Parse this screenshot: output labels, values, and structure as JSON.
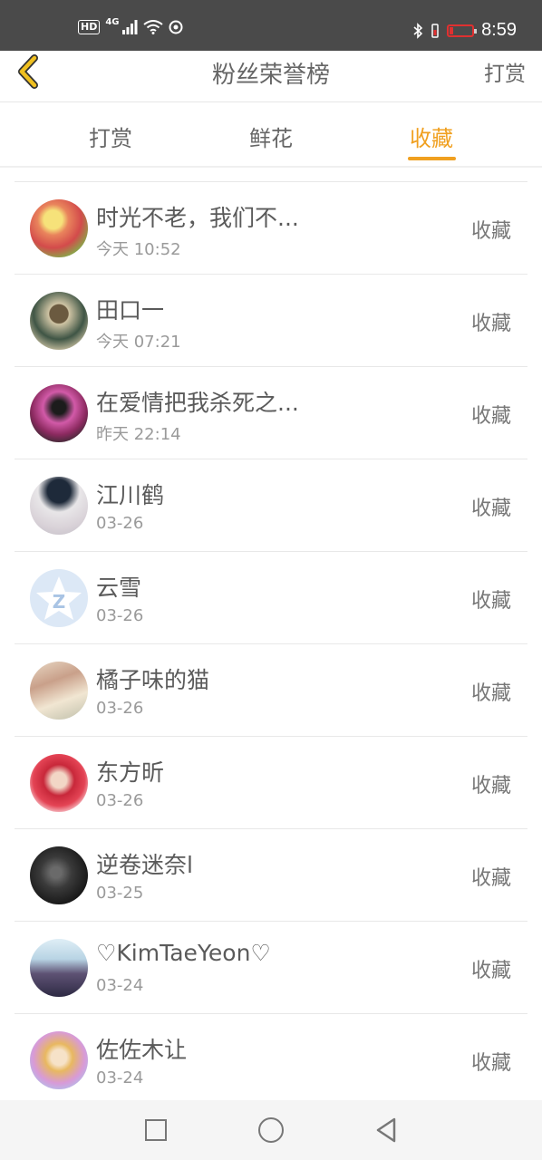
{
  "status_bar": {
    "hd": "HD",
    "network": "4G",
    "time": "8:59",
    "battery_color": "#e03030"
  },
  "header": {
    "title": "粉丝荣誉榜",
    "right_action": "打赏",
    "back_icon": "chevron-left-icon",
    "back_color": "#f0c020"
  },
  "tabs": [
    {
      "label": "打赏",
      "active": false
    },
    {
      "label": "鲜花",
      "active": false
    },
    {
      "label": "收藏",
      "active": true
    }
  ],
  "accent_color": "#f0a020",
  "fans": [
    {
      "name": "时光不老，我们不...",
      "time": "今天 10:52",
      "action": "收藏"
    },
    {
      "name": "田口一",
      "time": "今天 07:21",
      "action": "收藏"
    },
    {
      "name": "在爱情把我杀死之...",
      "time": "昨天 22:14",
      "action": "收藏"
    },
    {
      "name": "江川鹤",
      "time": "03-26",
      "action": "收藏"
    },
    {
      "name": "云雪",
      "time": "03-26",
      "action": "收藏"
    },
    {
      "name": "橘子味的猫",
      "time": "03-26",
      "action": "收藏"
    },
    {
      "name": "东方昕",
      "time": "03-26",
      "action": "收藏"
    },
    {
      "name": "逆卷迷奈l",
      "time": "03-25",
      "action": "收藏"
    },
    {
      "name": "♡KimTaeYeon♡",
      "time": "03-24",
      "action": "收藏"
    },
    {
      "name": "佐佐木让",
      "time": "03-24",
      "action": "收藏"
    }
  ],
  "nav_bar": {
    "icons": [
      "square-recents-icon",
      "circle-home-icon",
      "triangle-back-icon"
    ]
  }
}
